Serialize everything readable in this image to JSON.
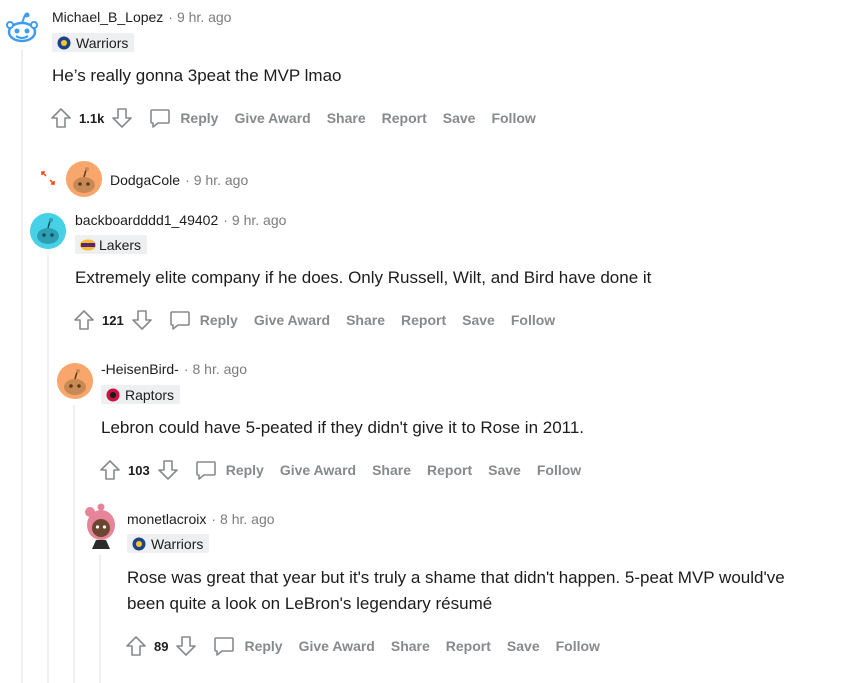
{
  "comments": [
    {
      "user": "Michael_B_Lopez",
      "time": "9 hr. ago",
      "flair": "Warriors",
      "flair_icon": "warriors-logo-icon",
      "body": [
        "He’s really gonna 3peat the MVP lmao"
      ],
      "score": "1.1k"
    },
    {
      "user": "DodgaCole",
      "time": "9 hr. ago",
      "collapsed": true
    },
    {
      "user": "backboardddd1_49402",
      "time": "9 hr. ago",
      "flair": "Lakers",
      "flair_icon": "lakers-logo-icon",
      "body": [
        "Extremely elite company if he does. Only Russell, Wilt, and Bird have done it"
      ],
      "score": "121"
    },
    {
      "user": "-HeisenBird-",
      "time": "8 hr. ago",
      "flair": "Raptors",
      "flair_icon": "raptors-logo-icon",
      "body": [
        "Lebron could have 5-peated if they didn't give it to Rose in 2011."
      ],
      "score": "103"
    },
    {
      "user": "monetlacroix",
      "time": "8 hr. ago",
      "flair": "Warriors",
      "flair_icon": "warriors-logo-icon",
      "body": [
        "Rose was great that year but it's truly a shame that didn't happen. 5-peat MVP would've",
        "been quite a look on LeBron's legendary résumé"
      ],
      "score": "89"
    }
  ],
  "actions": {
    "reply": "Reply",
    "give_award": "Give Award",
    "share": "Share",
    "report": "Report",
    "save": "Save",
    "follow": "Follow"
  },
  "colors": {
    "meta_gray": "#7c7c7c",
    "action_gray": "#878a8c",
    "thread_line": "#edeff1",
    "expand_icon": "#ff4500"
  }
}
